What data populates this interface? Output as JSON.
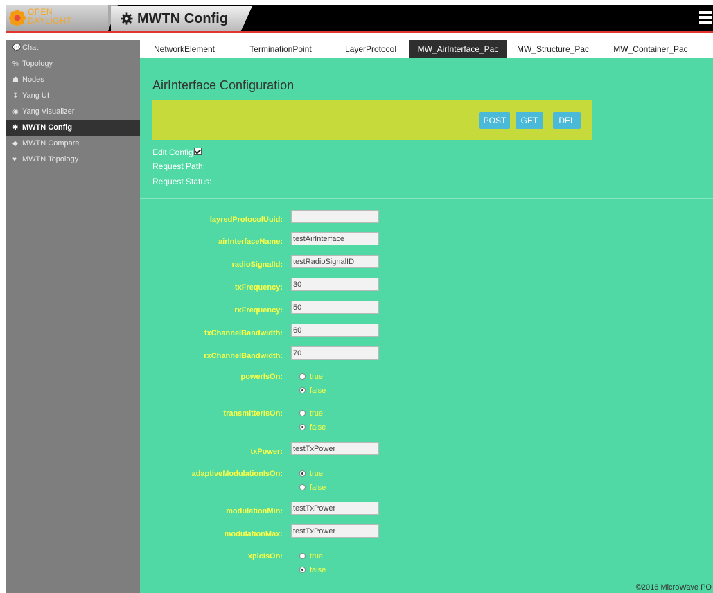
{
  "brand": {
    "line1": "OPEN",
    "line2": "DAYLIGHT",
    "accent": "#f5a623"
  },
  "header": {
    "title": "MWTN Config",
    "menu_icon": "hamburger-icon"
  },
  "sidebar": {
    "items": [
      {
        "label": "Chat",
        "icon": "chat-icon",
        "glyph": "💬",
        "active": false
      },
      {
        "label": "Topology",
        "icon": "topology-icon",
        "glyph": "%",
        "active": false
      },
      {
        "label": "Nodes",
        "icon": "nodes-icon",
        "glyph": "☗",
        "active": false
      },
      {
        "label": "Yang UI",
        "icon": "yang-ui-icon",
        "glyph": "↧",
        "active": false
      },
      {
        "label": "Yang Visualizer",
        "icon": "eye-icon",
        "glyph": "◉",
        "active": false
      },
      {
        "label": "MWTN Config",
        "icon": "gear-icon",
        "glyph": "✱",
        "active": true
      },
      {
        "label": "MWTN Compare",
        "icon": "tag-icon",
        "glyph": "◆",
        "active": false
      },
      {
        "label": "MWTN Topology",
        "icon": "heart-icon",
        "glyph": "♥",
        "active": false
      }
    ]
  },
  "tabs": [
    {
      "label": "NetworkElement",
      "active": false
    },
    {
      "label": "TerminationPoint",
      "active": false
    },
    {
      "label": "LayerProtocol",
      "active": false
    },
    {
      "label": "MW_AirInterface_Pac",
      "active": true
    },
    {
      "label": "MW_Structure_Pac",
      "active": false
    },
    {
      "label": "MW_Container_Pac",
      "active": false
    }
  ],
  "main": {
    "title": "AirInterface Configuration",
    "buttons": {
      "post": "POST",
      "get": "GET",
      "del": "DEL"
    },
    "edit_config_label": "Edit Config",
    "edit_config_checked": true,
    "request_path_label": "Request Path:",
    "request_status_label": "Request Status:"
  },
  "form": {
    "layredProtocolUuid": {
      "label": "layredProtocolUuid:",
      "value": ""
    },
    "airInterfaceName": {
      "label": "airInterfaceName:",
      "value": "testAirInterface"
    },
    "radioSignalId": {
      "label": "radioSignalId:",
      "value": "testRadioSignalID"
    },
    "txFrequency": {
      "label": "txFrequency:",
      "value": "30"
    },
    "rxFrequency": {
      "label": "rxFrequency:",
      "value": "50"
    },
    "txChannelBandwidth": {
      "label": "txChannelBandwidth:",
      "value": "60"
    },
    "rxChannelBandwidth": {
      "label": "rxChannelBandwidth:",
      "value": "70"
    },
    "powerIsOn": {
      "label": "powerIsOn:",
      "true_label": "true",
      "false_label": "false",
      "selected": "false"
    },
    "transmitterIsOn": {
      "label": "transmitterIsOn:",
      "true_label": "true",
      "false_label": "false",
      "selected": "false"
    },
    "txPower": {
      "label": "txPower:",
      "value": "testTxPower"
    },
    "adaptiveModulationIsOn": {
      "label": "adaptiveModulationIsOn:",
      "true_label": "true",
      "false_label": "false",
      "selected": "true"
    },
    "modulationMin": {
      "label": "modulationMin:",
      "value": "testTxPower"
    },
    "modulationMax": {
      "label": "modulationMax:",
      "value": "testTxPower"
    },
    "xpicIsOn": {
      "label": "xpicIsOn:",
      "true_label": "true",
      "false_label": "false",
      "selected": "false"
    }
  },
  "footer": {
    "text": "©2016 MicroWave PO"
  },
  "colors": {
    "main_bg": "#50d9a4",
    "action_bar": "#c6da3c",
    "button": "#4bb9d8",
    "label": "#ffff44",
    "sidebar": "#7e7e7e",
    "sidebar_active": "#333333",
    "header": "#000000",
    "header_line": "#e3342f"
  }
}
